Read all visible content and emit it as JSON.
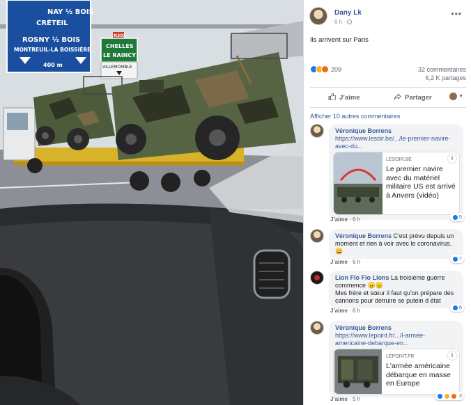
{
  "photo": {
    "sign_blue_line1": "NAY ½ BOIS",
    "sign_blue_line2": "CRÉTEIL",
    "sign_blue_line3": "ROSNY ½ BOIS",
    "sign_blue_line4": "MONTREUIL-LA BOISSIÈRE",
    "sign_blue_distance": "400 m",
    "sign_green_line1": "CHELLES",
    "sign_green_line2": "LE RAINCY",
    "sign_route": "N302",
    "sign_white": "VILLEMOMBLE"
  },
  "post": {
    "author": "Dany Lk",
    "time": "8 h ·",
    "caption": "Ils arrivent sur Paris",
    "reaction_count": "209",
    "comments_count": "32 commentaires",
    "shares_count": "6,2 K partages",
    "like_label": "J’aime",
    "share_label": "Partager"
  },
  "more_comments_label": "Afficher 10 autres commentaires",
  "comments": [
    {
      "name": "Véronique Borrens",
      "text": "https://www.lesoir.be/.../le-premier-navire-avec-du...",
      "like": "J’aime",
      "time": "6 h",
      "badge": "5",
      "card": {
        "source": "LESOIR.BE",
        "title": "Le premier navire avec du matériel militaire US est arrivé à Anvers (vidéo)"
      }
    },
    {
      "name": "Véronique Borrens",
      "text": "C'est prévu depuis un moment et rien à voir avec le coronavirus. 😀",
      "like": "J’aime",
      "time": "6 h",
      "badge": "7"
    },
    {
      "name": "Lion Flo Flo Lions",
      "text": "La troisième guerre commence 😠😠",
      "text2": "Mes frère et sœur il faut qu'on prépare des cannons pour detruire se putein d état",
      "like": "J’aime",
      "time": "6 h",
      "badge": "6"
    },
    {
      "name": "Véronique Borrens",
      "text": "https://www.lepoint.fr/.../l-armee-americaine-debarque-en...",
      "like": "J’aime",
      "time": "5 h",
      "badge": "3",
      "card": {
        "source": "LEPOINT.FR",
        "title": "L'armée américaine débarque en masse en Europe"
      }
    }
  ],
  "colors": {
    "link": "#385898",
    "like_blue": "#1877f2",
    "sign_blue": "#1a4fa0",
    "sign_green": "#1f7a3a",
    "camo_green": "#4e5b3a"
  }
}
